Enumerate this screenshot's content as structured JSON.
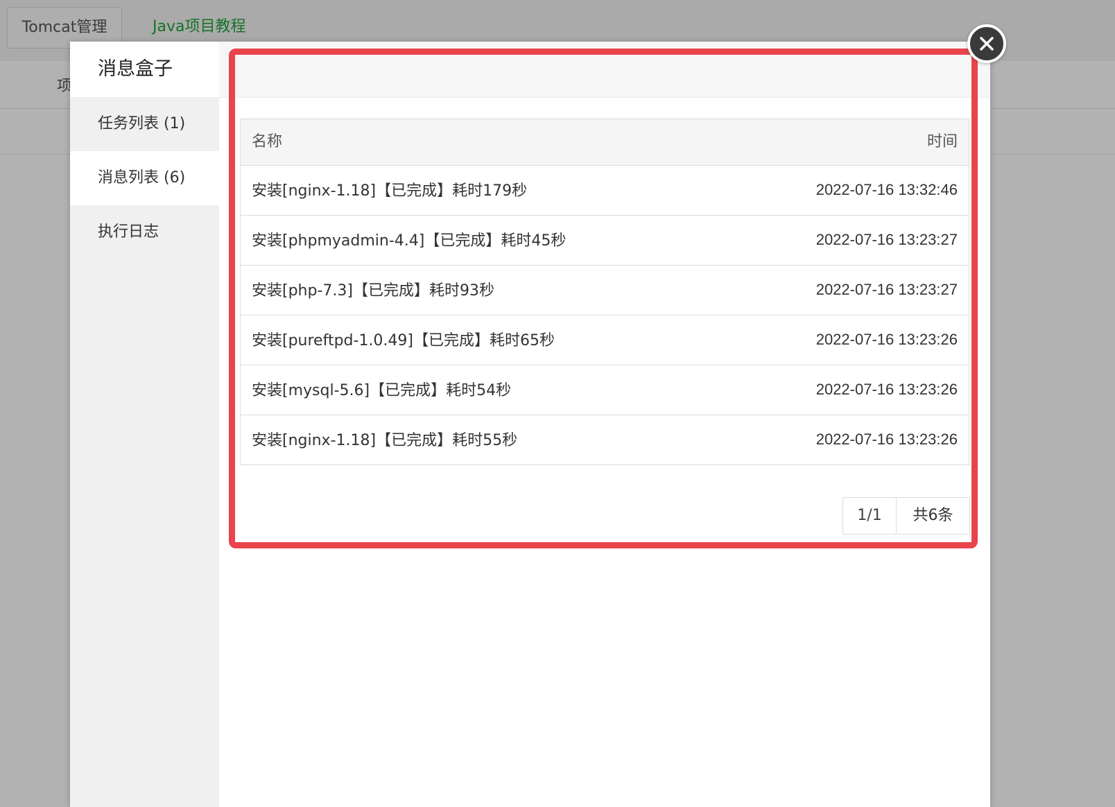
{
  "background": {
    "tabs": [
      "Tomcat管理",
      "Java项目教程"
    ],
    "cut_text": "项"
  },
  "modal": {
    "title": "消息盒子",
    "sidebar": [
      {
        "label": "任务列表 (1)",
        "active": false
      },
      {
        "label": "消息列表 (6)",
        "active": true
      },
      {
        "label": "执行日志",
        "active": false
      }
    ],
    "table": {
      "columns": [
        "名称",
        "时间"
      ],
      "rows": [
        {
          "name": "安装[nginx-1.18]【已完成】耗时179秒",
          "time": "2022-07-16 13:32:46"
        },
        {
          "name": "安装[phpmyadmin-4.4]【已完成】耗时45秒",
          "time": "2022-07-16 13:23:27"
        },
        {
          "name": "安装[php-7.3]【已完成】耗时93秒",
          "time": "2022-07-16 13:23:27"
        },
        {
          "name": "安装[pureftpd-1.0.49]【已完成】耗时65秒",
          "time": "2022-07-16 13:23:26"
        },
        {
          "name": "安装[mysql-5.6]【已完成】耗时54秒",
          "time": "2022-07-16 13:23:26"
        },
        {
          "name": "安装[nginx-1.18]【已完成】耗时55秒",
          "time": "2022-07-16 13:23:26"
        }
      ]
    },
    "pagination": {
      "page": "1/1",
      "total": "共6条"
    }
  },
  "colors": {
    "highlight": "#e9444c",
    "accent_green": "#20a53a"
  },
  "icons": {
    "close": "close-icon"
  }
}
